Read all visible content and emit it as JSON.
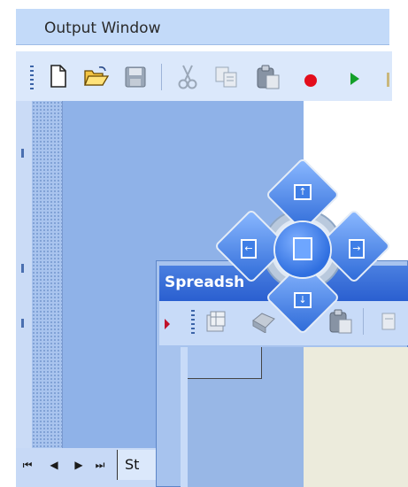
{
  "output_window": {
    "title": "Output Window"
  },
  "toolbar": {
    "icons": [
      "new-document-icon",
      "open-folder-icon",
      "save-icon",
      "cut-icon",
      "copy-icon",
      "paste-icon",
      "record-icon",
      "run-icon"
    ]
  },
  "spreadsheet_window": {
    "title": "Spreadsh"
  },
  "bottom_tabs": {
    "first": "⏮",
    "prev": "◀",
    "next": "▶",
    "last": "⏭",
    "sheet_tab_label": "St"
  },
  "dock_guide": {
    "top": "↑",
    "bottom": "↓",
    "left": "←",
    "right": "→"
  },
  "colors": {
    "overlay_blue": "#8fb2e8",
    "accent": "#2f6fe0",
    "title_bar": "#3a70d8"
  }
}
